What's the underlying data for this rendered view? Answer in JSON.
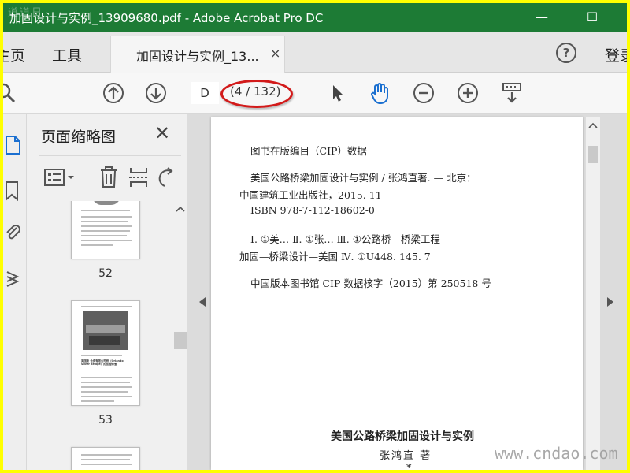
{
  "window": {
    "title": "加固设计与实例_13909680.pdf - Adobe Acrobat Pro DC",
    "watermark_top": "道道日",
    "minimize": "—",
    "maximize": "☐"
  },
  "nav": {
    "home": "主页",
    "tools": "工具",
    "doc_tab": "加固设计与实例_13...",
    "doc_tab_close": "×",
    "help": "?",
    "login": "登录"
  },
  "toolbar": {
    "page_input": "D",
    "page_count": "(4 / 132)"
  },
  "thumbnails": {
    "title": "页面缩略图",
    "close": "✕",
    "pages": [
      {
        "num": "52"
      },
      {
        "num": "53"
      }
    ],
    "thumb53_caption": "美国新 合资有限公司桥（Orlando Silver Bridge）的加固修缮"
  },
  "document": {
    "lines": [
      "图书在版编目（CIP）数据",
      "美国公路桥梁加固设计与实例 / 张鸿直著. — 北京：",
      "中国建筑工业出版社，2015. 11",
      "ISBN 978-7-112-18602-0",
      "Ⅰ. ①美…  Ⅱ. ①张…  Ⅲ. ①公路桥—桥梁工程—",
      "加固—桥梁设计—美国  Ⅳ. ①U448. 145. 7",
      "中国版本图书馆 CIP 数据核字（2015）第 250518 号",
      "美国公路桥梁加固设计与实例",
      "张鸿直  著",
      "*"
    ],
    "watermark": "www.cndao.com"
  },
  "colors": {
    "titlebar": "#1d7b35",
    "highlight": "#d21a1a",
    "hand_tool": "#1a6fd0",
    "frame_border": "#ffff00"
  }
}
